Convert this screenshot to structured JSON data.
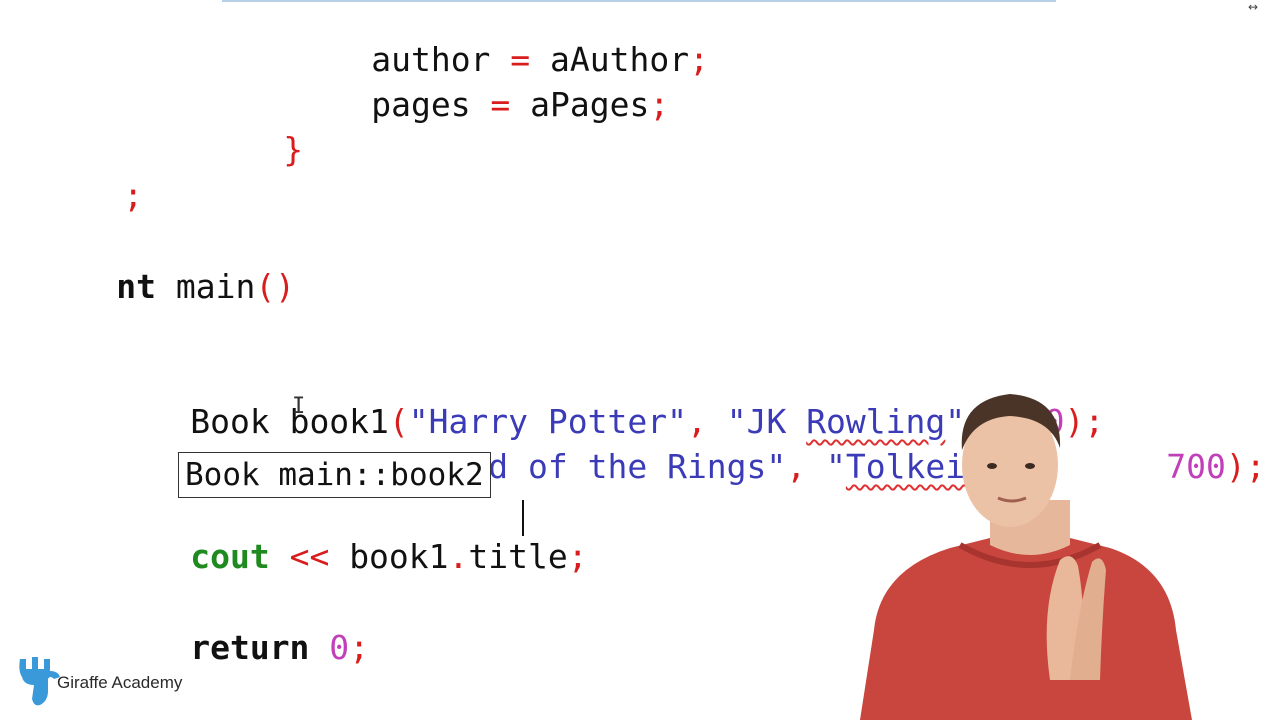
{
  "editor": {
    "lines": {
      "l1": {
        "a": "author",
        "b": " = ",
        "c": "aAuthor",
        "d": ";"
      },
      "l2": {
        "a": "pages",
        "b": " = ",
        "c": "aPages",
        "d": ";"
      },
      "l3": {
        "brace": "}"
      },
      "l4": {
        "semi": ";"
      },
      "l5": {
        "kw": "nt",
        "name": " main",
        "parens": "()"
      },
      "l6": {
        "type": "Book",
        "var": " book1",
        "open": "(",
        "s1": "\"Harry Potter\"",
        "c1": ", ",
        "s2a": "\"JK ",
        "s2b": "Rowling",
        "s2c": "\"",
        "c2": ", ",
        "n": "500",
        "close": ");"
      },
      "l7": {
        "type": "Book",
        "var": " book2",
        "open": "(",
        "s1": "\"Lord of the Rings\"",
        "c1": ", ",
        "s2a": "\"",
        "s2b": "Tolkein",
        "s2c": "",
        "c2": "",
        "n": "700",
        "close": ");"
      },
      "l8": {
        "kw": "cout",
        "op": " << ",
        "obj": "book1",
        "dot": ".",
        "field": "title",
        "semi": ";"
      },
      "l9": {
        "kw": "return",
        "n": " 0",
        "semi": ";"
      }
    },
    "tooltip": "Book main::book2"
  },
  "watermark": {
    "brand": "Giraffe Academy",
    "logo_icon": "giraffe-icon",
    "logo_color": "#3a9ad9"
  },
  "colors": {
    "keyword_green": "#1f8a1f",
    "punctuation_red": "#d91c1c",
    "string_blue": "#3b3bb8",
    "number_magenta": "#c13fb8"
  }
}
